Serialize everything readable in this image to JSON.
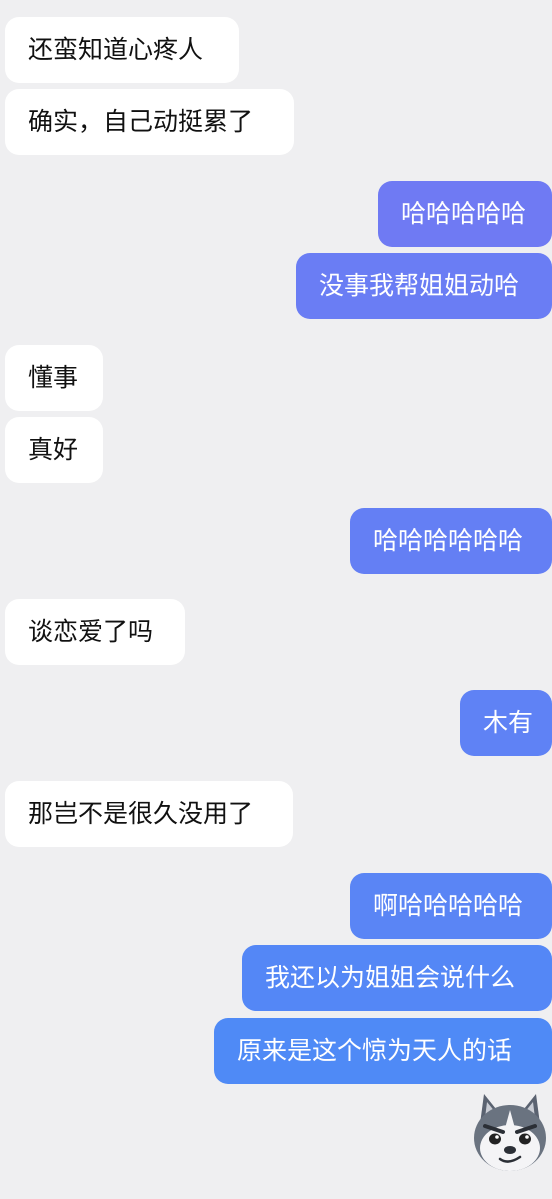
{
  "theme": {
    "background": "#efeff1",
    "incoming_bubble": "#ffffff",
    "outgoing_bubble_top": "#6f7af3",
    "outgoing_bubble_bottom": "#4f8af6"
  },
  "messages": [
    {
      "side": "in",
      "text": "还蛮知道心疼人"
    },
    {
      "side": "in",
      "text": "确实，自己动挺累了"
    },
    {
      "side": "out",
      "text": "哈哈哈哈哈"
    },
    {
      "side": "out",
      "text": "没事我帮姐姐动哈"
    },
    {
      "side": "in",
      "text": "懂事"
    },
    {
      "side": "in",
      "text": "真好"
    },
    {
      "side": "out",
      "text": "哈哈哈哈哈哈"
    },
    {
      "side": "in",
      "text": "谈恋爱了吗"
    },
    {
      "side": "out",
      "text": "木有"
    },
    {
      "side": "in",
      "text": "那岂不是很久没用了"
    },
    {
      "side": "out",
      "text": "啊哈哈哈哈哈"
    },
    {
      "side": "out",
      "text": "我还以为姐姐会说什么"
    },
    {
      "side": "out",
      "text": "原来是这个惊为天人的话"
    }
  ],
  "sticker": {
    "icon": "wolf-emoji-sticker"
  }
}
